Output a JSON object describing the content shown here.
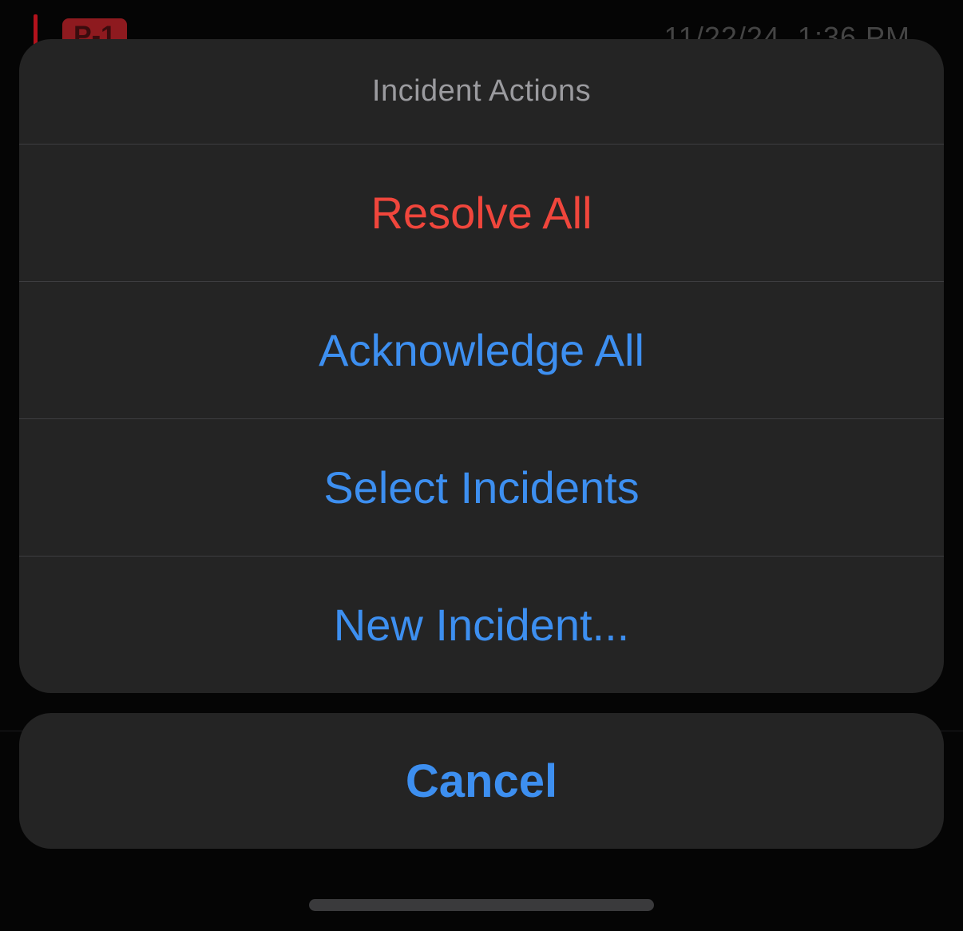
{
  "background": {
    "priority_badge": "P-1",
    "timestamp": "11/22/24, 1:36 PM"
  },
  "action_sheet": {
    "title": "Incident Actions",
    "actions": [
      {
        "label": "Resolve All",
        "style": "destructive",
        "color": "#f0463c"
      },
      {
        "label": "Acknowledge All",
        "style": "default",
        "color": "#3d8ff0"
      },
      {
        "label": "Select Incidents",
        "style": "default",
        "color": "#3d8ff0"
      },
      {
        "label": "New Incident...",
        "style": "default",
        "color": "#3d8ff0"
      }
    ],
    "cancel_label": "Cancel"
  }
}
